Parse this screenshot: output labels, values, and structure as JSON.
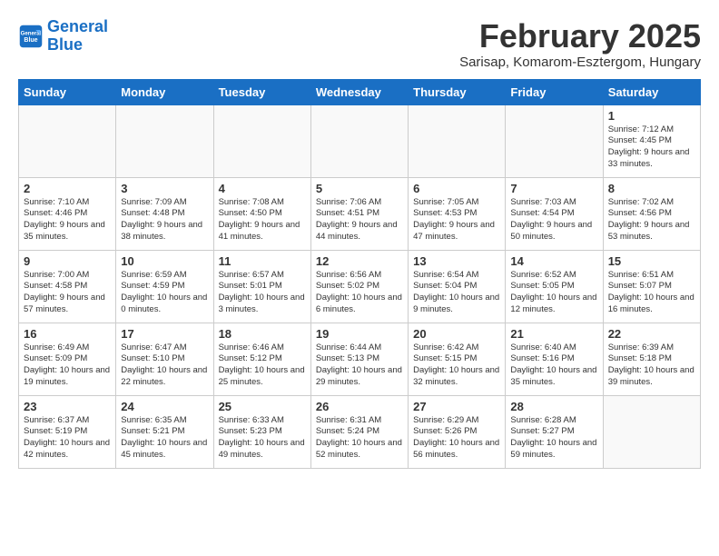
{
  "header": {
    "logo_line1": "General",
    "logo_line2": "Blue",
    "month_title": "February 2025",
    "subtitle": "Sarisap, Komarom-Esztergom, Hungary"
  },
  "days_of_week": [
    "Sunday",
    "Monday",
    "Tuesday",
    "Wednesday",
    "Thursday",
    "Friday",
    "Saturday"
  ],
  "weeks": [
    [
      {
        "day": "",
        "info": ""
      },
      {
        "day": "",
        "info": ""
      },
      {
        "day": "",
        "info": ""
      },
      {
        "day": "",
        "info": ""
      },
      {
        "day": "",
        "info": ""
      },
      {
        "day": "",
        "info": ""
      },
      {
        "day": "1",
        "info": "Sunrise: 7:12 AM\nSunset: 4:45 PM\nDaylight: 9 hours and 33 minutes."
      }
    ],
    [
      {
        "day": "2",
        "info": "Sunrise: 7:10 AM\nSunset: 4:46 PM\nDaylight: 9 hours and 35 minutes."
      },
      {
        "day": "3",
        "info": "Sunrise: 7:09 AM\nSunset: 4:48 PM\nDaylight: 9 hours and 38 minutes."
      },
      {
        "day": "4",
        "info": "Sunrise: 7:08 AM\nSunset: 4:50 PM\nDaylight: 9 hours and 41 minutes."
      },
      {
        "day": "5",
        "info": "Sunrise: 7:06 AM\nSunset: 4:51 PM\nDaylight: 9 hours and 44 minutes."
      },
      {
        "day": "6",
        "info": "Sunrise: 7:05 AM\nSunset: 4:53 PM\nDaylight: 9 hours and 47 minutes."
      },
      {
        "day": "7",
        "info": "Sunrise: 7:03 AM\nSunset: 4:54 PM\nDaylight: 9 hours and 50 minutes."
      },
      {
        "day": "8",
        "info": "Sunrise: 7:02 AM\nSunset: 4:56 PM\nDaylight: 9 hours and 53 minutes."
      }
    ],
    [
      {
        "day": "9",
        "info": "Sunrise: 7:00 AM\nSunset: 4:58 PM\nDaylight: 9 hours and 57 minutes."
      },
      {
        "day": "10",
        "info": "Sunrise: 6:59 AM\nSunset: 4:59 PM\nDaylight: 10 hours and 0 minutes."
      },
      {
        "day": "11",
        "info": "Sunrise: 6:57 AM\nSunset: 5:01 PM\nDaylight: 10 hours and 3 minutes."
      },
      {
        "day": "12",
        "info": "Sunrise: 6:56 AM\nSunset: 5:02 PM\nDaylight: 10 hours and 6 minutes."
      },
      {
        "day": "13",
        "info": "Sunrise: 6:54 AM\nSunset: 5:04 PM\nDaylight: 10 hours and 9 minutes."
      },
      {
        "day": "14",
        "info": "Sunrise: 6:52 AM\nSunset: 5:05 PM\nDaylight: 10 hours and 12 minutes."
      },
      {
        "day": "15",
        "info": "Sunrise: 6:51 AM\nSunset: 5:07 PM\nDaylight: 10 hours and 16 minutes."
      }
    ],
    [
      {
        "day": "16",
        "info": "Sunrise: 6:49 AM\nSunset: 5:09 PM\nDaylight: 10 hours and 19 minutes."
      },
      {
        "day": "17",
        "info": "Sunrise: 6:47 AM\nSunset: 5:10 PM\nDaylight: 10 hours and 22 minutes."
      },
      {
        "day": "18",
        "info": "Sunrise: 6:46 AM\nSunset: 5:12 PM\nDaylight: 10 hours and 25 minutes."
      },
      {
        "day": "19",
        "info": "Sunrise: 6:44 AM\nSunset: 5:13 PM\nDaylight: 10 hours and 29 minutes."
      },
      {
        "day": "20",
        "info": "Sunrise: 6:42 AM\nSunset: 5:15 PM\nDaylight: 10 hours and 32 minutes."
      },
      {
        "day": "21",
        "info": "Sunrise: 6:40 AM\nSunset: 5:16 PM\nDaylight: 10 hours and 35 minutes."
      },
      {
        "day": "22",
        "info": "Sunrise: 6:39 AM\nSunset: 5:18 PM\nDaylight: 10 hours and 39 minutes."
      }
    ],
    [
      {
        "day": "23",
        "info": "Sunrise: 6:37 AM\nSunset: 5:19 PM\nDaylight: 10 hours and 42 minutes."
      },
      {
        "day": "24",
        "info": "Sunrise: 6:35 AM\nSunset: 5:21 PM\nDaylight: 10 hours and 45 minutes."
      },
      {
        "day": "25",
        "info": "Sunrise: 6:33 AM\nSunset: 5:23 PM\nDaylight: 10 hours and 49 minutes."
      },
      {
        "day": "26",
        "info": "Sunrise: 6:31 AM\nSunset: 5:24 PM\nDaylight: 10 hours and 52 minutes."
      },
      {
        "day": "27",
        "info": "Sunrise: 6:29 AM\nSunset: 5:26 PM\nDaylight: 10 hours and 56 minutes."
      },
      {
        "day": "28",
        "info": "Sunrise: 6:28 AM\nSunset: 5:27 PM\nDaylight: 10 hours and 59 minutes."
      },
      {
        "day": "",
        "info": ""
      }
    ]
  ]
}
